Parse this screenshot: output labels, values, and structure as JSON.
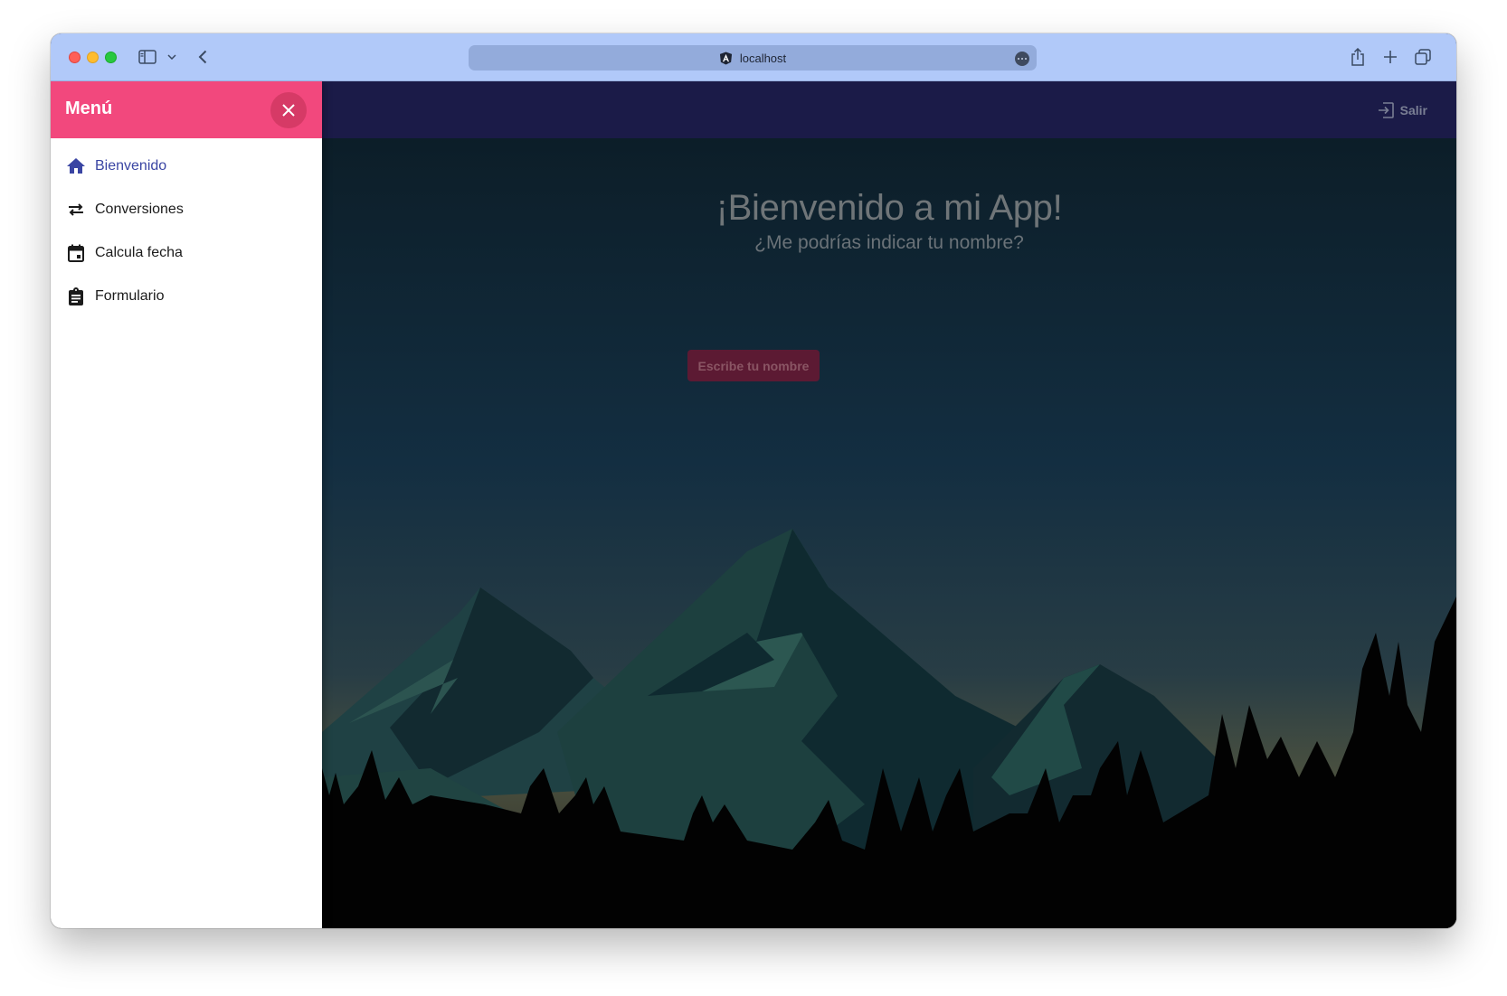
{
  "browser": {
    "url": "localhost"
  },
  "topbar": {
    "logout_label": "Salir"
  },
  "drawer": {
    "title": "Menú",
    "items": [
      {
        "label": "Bienvenido",
        "icon": "home-icon",
        "active": true
      },
      {
        "label": "Conversiones",
        "icon": "swap-arrows-icon",
        "active": false
      },
      {
        "label": "Calcula fecha",
        "icon": "calendar-icon",
        "active": false
      },
      {
        "label": "Formulario",
        "icon": "clipboard-icon",
        "active": false
      }
    ]
  },
  "hero": {
    "title": "¡Bienvenido a mi App!",
    "subtitle": "¿Me podrías indicar tu nombre?",
    "button_label": "Escribe tu nombre"
  },
  "colors": {
    "chrome": "#b1c9f9",
    "drawer_header": "#f2487d",
    "topbar": "#1b1b48",
    "accent_active": "#3a45a3",
    "button": "#5c1a33"
  }
}
